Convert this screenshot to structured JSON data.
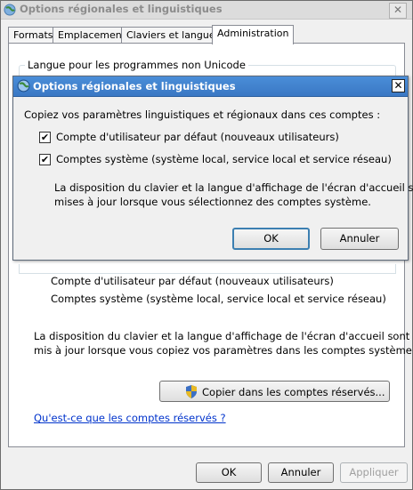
{
  "main_window": {
    "title": "Options régionales et linguistiques",
    "close_glyph": "✕"
  },
  "tabs": [
    {
      "label": "Formats"
    },
    {
      "label": "Emplacement"
    },
    {
      "label": "Claviers et langues"
    },
    {
      "label": "Administration"
    }
  ],
  "active_tab": "Administration",
  "non_unicode_group": {
    "legend": "Langue pour les programmes non Unicode"
  },
  "reserved_accounts": {
    "account_default": "Compte d'utilisateur par défaut (nouveaux utilisateurs)",
    "account_system": "Comptes système (système local, service local et service réseau)",
    "info_line1": "La disposition du clavier et la langue d'affichage de l'écran d'accueil sont",
    "info_line2": "mis à jour lorsque vous copiez vos paramètres dans les comptes système.",
    "copy_button": "Copier dans les comptes réservés...",
    "help_link": "Qu'est-ce que les comptes réservés ?"
  },
  "footer": {
    "ok": "OK",
    "cancel": "Annuler",
    "apply": "Appliquer"
  },
  "dialog": {
    "title": "Options régionales et linguistiques",
    "close_glyph": "✕",
    "prompt": "Copiez vos paramètres linguistiques et régionaux dans ces comptes :",
    "checkbox_default_label": "Compte d'utilisateur par défaut (nouveaux utilisateurs)",
    "checkbox_default_checked": true,
    "checkbox_system_label": "Comptes système (système local, service local et service réseau)",
    "checkbox_system_checked": true,
    "check_glyph": "✔",
    "note_line1": "La disposition du clavier et la langue d'affichage de l'écran d'accueil sont",
    "note_line2": "mises à jour lorsque vous sélectionnez des comptes système.",
    "ok": "OK",
    "cancel": "Annuler"
  },
  "colors": {
    "dialog_titlebar": "#3a78c4",
    "link": "#0033cc",
    "disabled_text": "#a0a0a0"
  },
  "icons": {
    "app": "globe-icon",
    "uac_shield": "shield-icon"
  }
}
